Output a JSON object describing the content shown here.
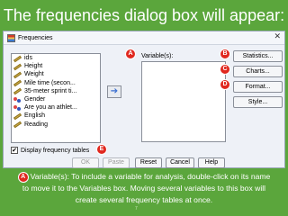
{
  "slide": {
    "title": "The frequencies dialog box will appear:",
    "caption_badge": "A",
    "caption_lines": [
      "Variable(s): To include a variable for analysis, double-click on its name",
      "to move it to the Variables box. Moving several variables to this box will",
      "create several frequency tables at once."
    ],
    "page_number": "7"
  },
  "dialog": {
    "title": "Frequencies",
    "close_glyph": "✕",
    "variables": [
      {
        "label": "ids",
        "icon": "scale-ruler-icon"
      },
      {
        "label": "Height",
        "icon": "scale-ruler-icon"
      },
      {
        "label": "Weight",
        "icon": "scale-ruler-icon"
      },
      {
        "label": "Mile time (secon...",
        "icon": "scale-ruler-icon"
      },
      {
        "label": "35-meter sprint ti...",
        "icon": "scale-ruler-icon"
      },
      {
        "label": "Gender",
        "icon": "nominal-icon"
      },
      {
        "label": "Are you an athlet...",
        "icon": "nominal-icon"
      },
      {
        "label": "English",
        "icon": "scale-ruler-icon"
      },
      {
        "label": "Reading",
        "icon": "scale-ruler-icon"
      }
    ],
    "move_arrow": "➔",
    "variables_label": "Variable(s):",
    "buttons": {
      "statistics": "Statistics...",
      "charts": "Charts...",
      "format": "Format...",
      "style": "Style...",
      "ok": "OK",
      "paste": "Paste",
      "reset": "Reset",
      "cancel": "Cancel",
      "help": "Help"
    },
    "checkbox": {
      "label": "Display frequency tables",
      "checked": true,
      "mark": "✔"
    },
    "badges": {
      "a": "A",
      "b": "B",
      "c": "C",
      "d": "D",
      "e": "E"
    }
  },
  "colors": {
    "background": "#5ba63c",
    "badge": "#e0281f",
    "dialog": "#eef1f7"
  }
}
